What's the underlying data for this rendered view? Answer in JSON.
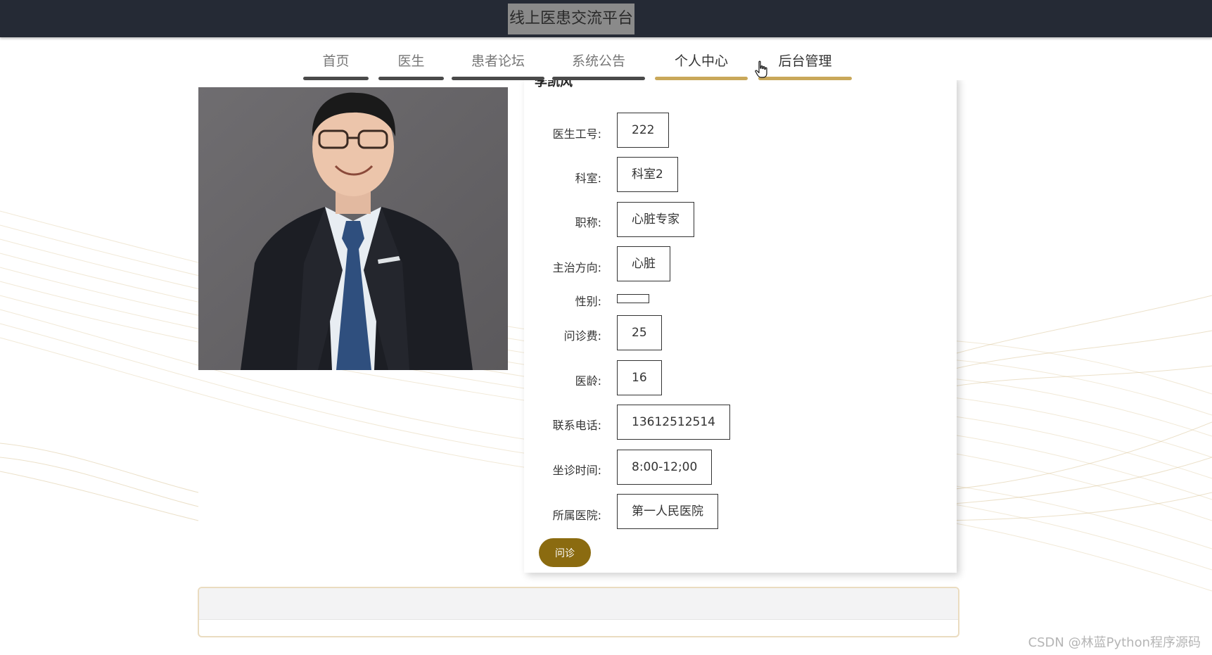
{
  "header": {
    "site_title": "线上医患交流平台"
  },
  "nav": {
    "items": [
      {
        "label": "首页"
      },
      {
        "label": "医生"
      },
      {
        "label": "患者论坛"
      },
      {
        "label": "系统公告"
      },
      {
        "label": "个人中心"
      },
      {
        "label": "后台管理"
      }
    ]
  },
  "doctor": {
    "name": "李凯风",
    "photo_icon": "doctor-portrait",
    "fields": [
      {
        "label": "医生工号:",
        "value": "222"
      },
      {
        "label": "科室:",
        "value": "科室2"
      },
      {
        "label": "职称:",
        "value": "心脏专家"
      },
      {
        "label": "主治方向:",
        "value": "心脏"
      },
      {
        "label": "性别:",
        "value": ""
      },
      {
        "label": "问诊费:",
        "value": "25"
      },
      {
        "label": "医龄:",
        "value": "16"
      },
      {
        "label": "联系电话:",
        "value": "13612512514"
      },
      {
        "label": "坐诊时间:",
        "value": "8:00-12;00"
      },
      {
        "label": "所属医院:",
        "value": "第一人民医院"
      }
    ],
    "consult_label": "问诊"
  },
  "watermark": "CSDN @林蓝Python程序源码",
  "colors": {
    "header_bg": "#252a35",
    "accent_gold": "#c9a85a",
    "button_brown": "#8b6b10",
    "nav_dark": "#4a4a4a"
  }
}
